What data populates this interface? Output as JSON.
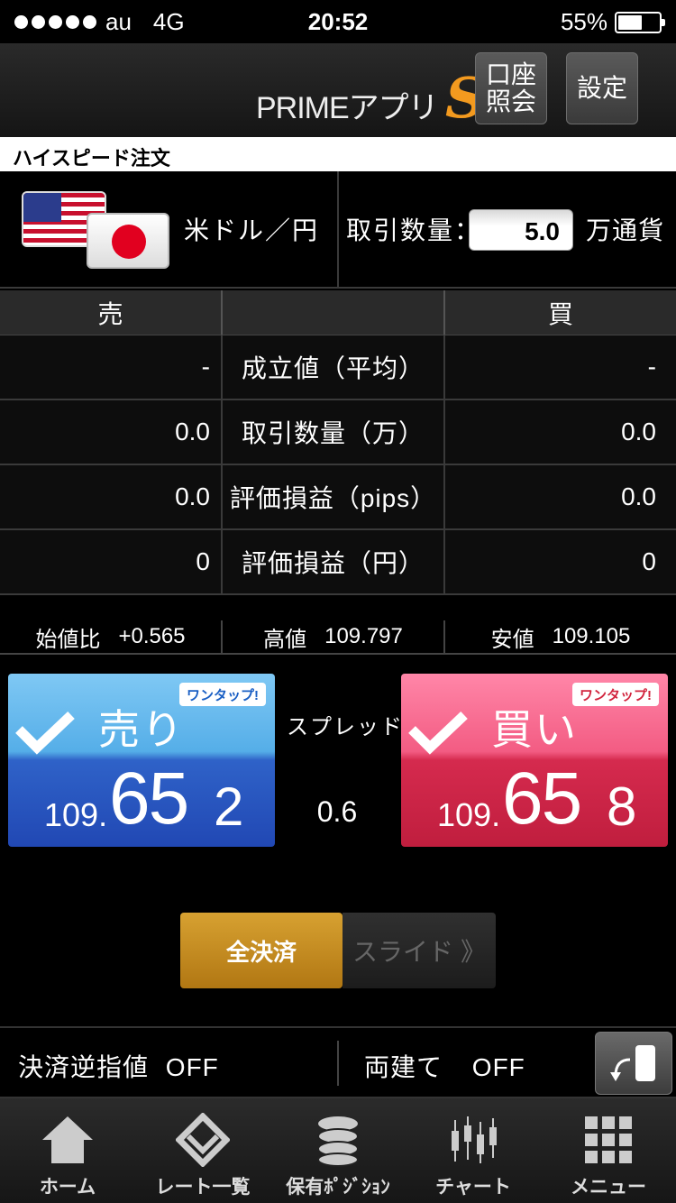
{
  "status_bar": {
    "carrier": "au",
    "network": "4G",
    "time": "20:52",
    "battery": "55%"
  },
  "header": {
    "logo": "PRIMEアプリ",
    "logo_mark": "S",
    "account_button": "口座\n照会",
    "settings_button": "設定"
  },
  "title": "ハイスピード注文",
  "pair": {
    "name": "米ドル／円",
    "qty_label": "取引数量：",
    "qty_value": "5.0",
    "qty_unit": "万通貨"
  },
  "table": {
    "headers": [
      "売",
      "",
      "買"
    ],
    "rows": [
      {
        "sell": "-",
        "label": "成立値（平均）",
        "buy": "-"
      },
      {
        "sell": "0.0",
        "label": "取引数量（万）",
        "buy": "0.0"
      },
      {
        "sell": "0.0",
        "label": "評価損益（pips）",
        "buy": "0.0"
      },
      {
        "sell": "0",
        "label": "評価損益（円）",
        "buy": "0"
      }
    ]
  },
  "stats": {
    "open_label": "始値比",
    "open_value": "+0.565",
    "high_label": "高値",
    "high_value": "109.797",
    "low_label": "安値",
    "low_value": "109.105"
  },
  "sell": {
    "badge": "ワンタップ!",
    "label": "売り",
    "price_prefix": "109.",
    "price_big": "65",
    "price_last": "2",
    "color": "#2148b4"
  },
  "buy": {
    "badge": "ワンタップ!",
    "label": "買い",
    "price_prefix": "109.",
    "price_big": "65",
    "price_last": "8",
    "color": "#c01e3e"
  },
  "spread": {
    "label": "スプレッド",
    "value": "0.6"
  },
  "slide": {
    "knob": "全決済",
    "track": "スライド",
    "arrow": "》"
  },
  "options": {
    "stop_label": "決済逆指値",
    "stop_value": "OFF",
    "hedge_label": "両建て",
    "hedge_value": "OFF"
  },
  "tabs": [
    {
      "label": "ホーム",
      "icon": "home-icon"
    },
    {
      "label": "レート一覧",
      "icon": "rate-list-icon"
    },
    {
      "label": "保有ﾎﾟｼﾞｼｮﾝ",
      "icon": "position-icon"
    },
    {
      "label": "チャート",
      "icon": "chart-icon"
    },
    {
      "label": "メニュー",
      "icon": "menu-grid-icon"
    }
  ]
}
